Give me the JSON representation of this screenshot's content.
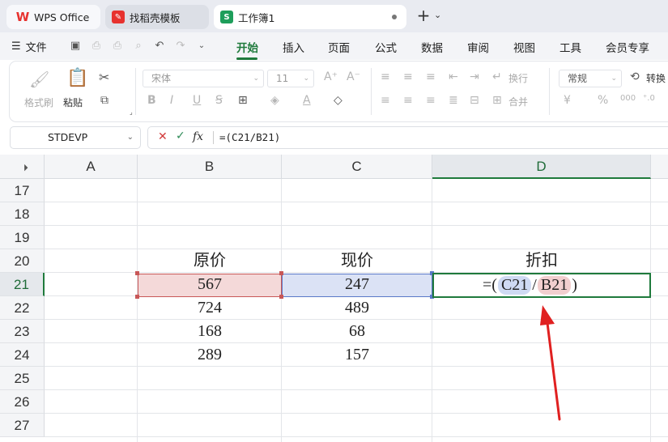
{
  "titlebar": {
    "tabs": [
      {
        "label": "WPS Office"
      },
      {
        "label": "找稻壳模板"
      },
      {
        "label": "工作簿1",
        "logo": "S"
      }
    ],
    "new_tab": "+",
    "tab_menu": "⌄"
  },
  "menubar": {
    "file": "文件",
    "tabs": [
      "开始",
      "插入",
      "页面",
      "公式",
      "数据",
      "审阅",
      "视图",
      "工具",
      "会员专享"
    ],
    "active_tab": "开始"
  },
  "ribbon": {
    "format_painter": "格式刷",
    "paste": "粘贴",
    "font_name": "宋体",
    "font_size": "11",
    "wrap": "换行",
    "merge": "合并",
    "number_format": "常规",
    "convert": "转换"
  },
  "formula_bar": {
    "name_box": "STDEVP",
    "formula": "=(C21/B21)",
    "fx_label": "fx"
  },
  "sheet": {
    "columns": [
      "A",
      "B",
      "C",
      "D"
    ],
    "active_column": "D",
    "rows": [
      "17",
      "18",
      "19",
      "20",
      "21",
      "22",
      "23",
      "24",
      "25",
      "26",
      "27"
    ],
    "active_row": "21",
    "headers": {
      "B": "原价",
      "C": "现价",
      "D": "折扣"
    },
    "data": [
      {
        "row": "21",
        "B": "567",
        "C": "247"
      },
      {
        "row": "22",
        "B": "724",
        "C": "489"
      },
      {
        "row": "23",
        "B": "168",
        "C": "68"
      },
      {
        "row": "24",
        "B": "289",
        "C": "157"
      }
    ],
    "editing": {
      "prefix": "=(",
      "ref1": "C21",
      "op": "/",
      "ref2": "B21",
      "suffix": ")"
    }
  },
  "colors": {
    "accent_green": "#1f7a3c",
    "ref_red": "#c85757",
    "ref_blue": "#5a78c8",
    "annotation_arrow": "#e02020"
  }
}
